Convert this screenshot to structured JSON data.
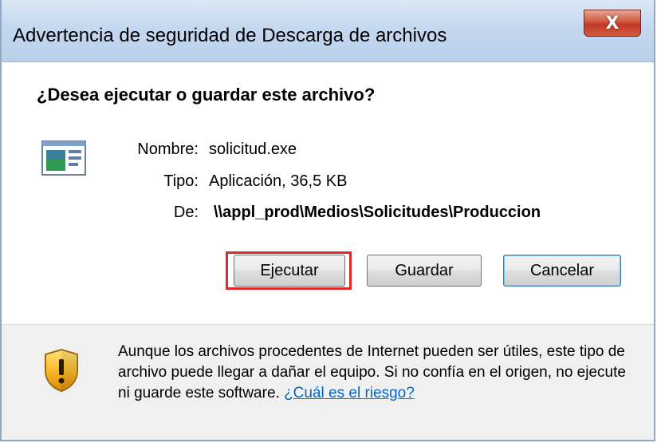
{
  "window": {
    "title": "Advertencia de seguridad de Descarga de archivos",
    "close_label": "X"
  },
  "dialog": {
    "question": "¿Desea ejecutar o guardar este archivo?",
    "file": {
      "icon": "application-window-icon",
      "name_label": "Nombre:",
      "name_value": "solicitud.exe",
      "type_label": "Tipo:",
      "type_value": "Aplicación, 36,5 KB",
      "from_label": "De:",
      "from_value": "\\\\appl_prod\\Medios\\Solicitudes\\Produccion"
    },
    "buttons": {
      "run": "Ejecutar",
      "save": "Guardar",
      "cancel": "Cancelar"
    }
  },
  "footer": {
    "icon": "security-shield-warning-icon",
    "warning_text": "Aunque los archivos procedentes de Internet pueden ser útiles, este tipo de archivo puede llegar a dañar el equipo. Si no confía en el origen, no ejecute ni guarde este software. ",
    "risk_link": "¿Cuál es el riesgo?"
  },
  "colors": {
    "highlight": "#e02828",
    "link": "#0066cc",
    "close_button": "#c0392b"
  }
}
